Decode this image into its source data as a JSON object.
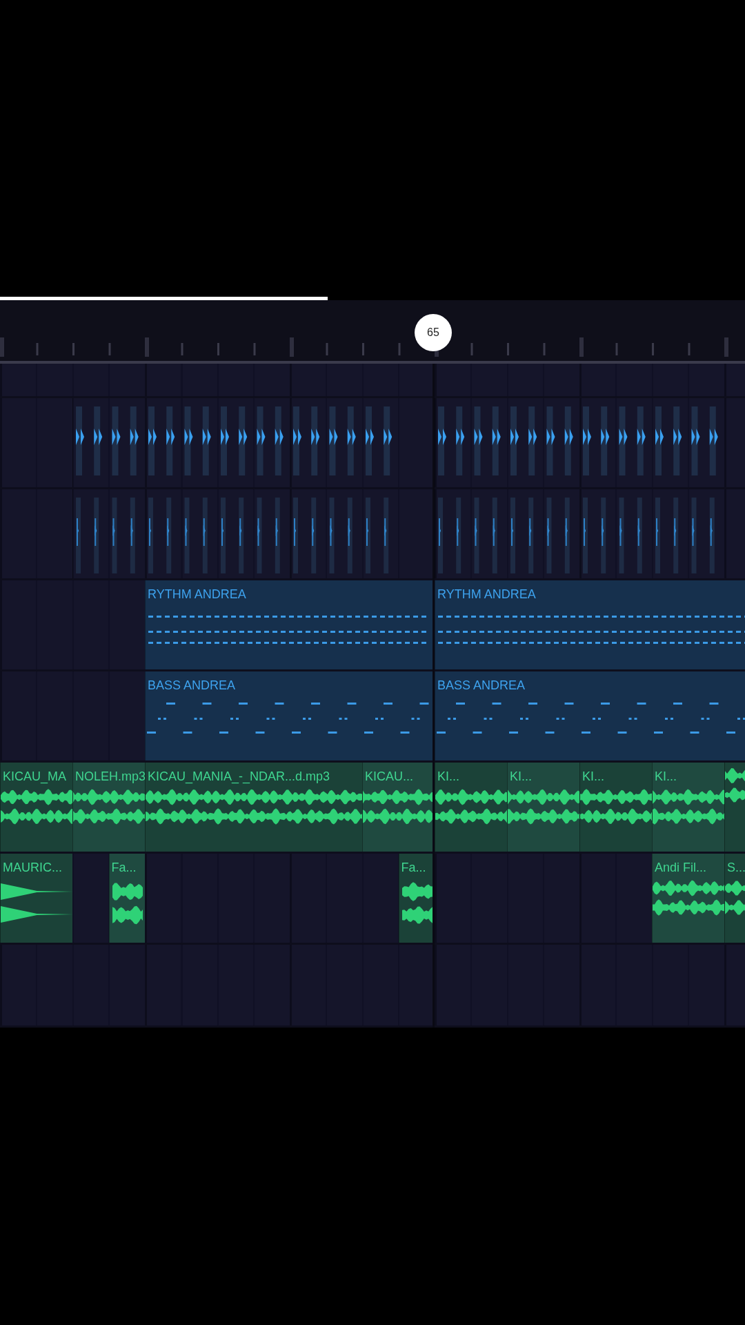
{
  "progress": {
    "level": 0.44
  },
  "playhead": {
    "label": "65"
  },
  "tracks": [
    {
      "kind": "pattern",
      "clips": [
        {
          "kind": "kick"
        },
        {
          "kind": "kick"
        }
      ]
    },
    {
      "kind": "pattern",
      "clips": [
        {
          "kind": "hat"
        },
        {
          "kind": "hat"
        }
      ]
    },
    {
      "kind": "notes",
      "clips": [
        {
          "kind": "chords",
          "label": "RYTHM ANDREA"
        },
        {
          "kind": "chords",
          "label": "RYTHM ANDREA"
        }
      ]
    },
    {
      "kind": "notes",
      "clips": [
        {
          "kind": "bass",
          "label": "BASS ANDREA"
        },
        {
          "kind": "bass",
          "label": "BASS ANDREA"
        }
      ]
    },
    {
      "kind": "audio",
      "clips": [
        {
          "kind": "audio",
          "label": "KICAU_MA"
        },
        {
          "kind": "audio",
          "label": "NOLEH.mp3"
        },
        {
          "kind": "audio",
          "label": "KICAU_MANIA_-_NDAR...d.mp3"
        },
        {
          "kind": "audio",
          "label": "KICAU..."
        },
        {
          "kind": "audio",
          "label": "KI..."
        },
        {
          "kind": "audio",
          "label": "KI..."
        },
        {
          "kind": "audio",
          "label": "KI..."
        },
        {
          "kind": "audio",
          "label": "KI..."
        },
        {
          "kind": "audio"
        }
      ]
    },
    {
      "kind": "audio",
      "clips": [
        {
          "kind": "fade",
          "label": "MAURIC..."
        },
        {
          "kind": "burst",
          "label": "Fa..."
        },
        {
          "kind": "burst",
          "label": "Fa..."
        },
        {
          "kind": "audio",
          "label": "Andi Fil..."
        },
        {
          "kind": "audio",
          "label": "S..."
        }
      ]
    },
    {
      "kind": "empty"
    }
  ]
}
